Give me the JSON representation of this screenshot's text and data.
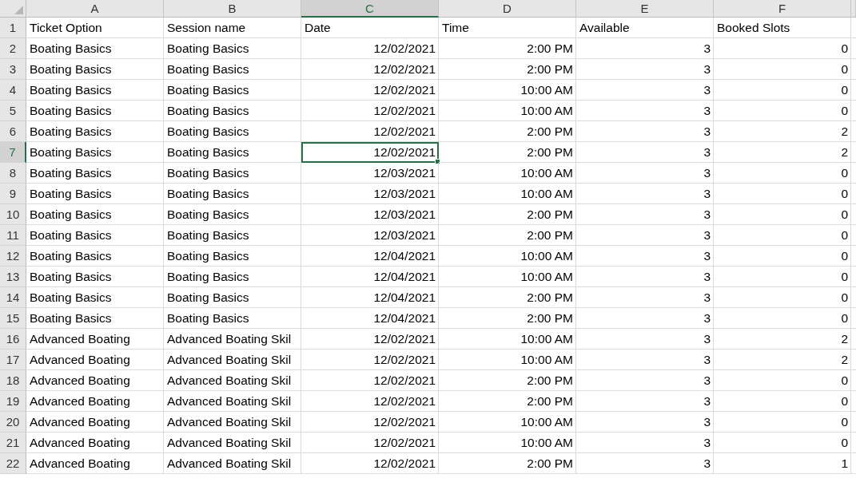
{
  "columns": [
    {
      "letter": "A",
      "selected": false,
      "kind": "text"
    },
    {
      "letter": "B",
      "selected": false,
      "kind": "text"
    },
    {
      "letter": "C",
      "selected": true,
      "kind": "number"
    },
    {
      "letter": "D",
      "selected": false,
      "kind": "number"
    },
    {
      "letter": "E",
      "selected": false,
      "kind": "number"
    },
    {
      "letter": "F",
      "selected": false,
      "kind": "number"
    }
  ],
  "rows": [
    {
      "number": "1",
      "selected": false,
      "kind": "header",
      "cells": [
        "Ticket Option",
        "Session name",
        "Date",
        "Time",
        "Available",
        "Booked Slots"
      ]
    },
    {
      "number": "2",
      "selected": false,
      "cells": [
        "Boating Basics",
        "Boating Basics",
        "12/02/2021",
        "2:00 PM",
        "3",
        "0"
      ]
    },
    {
      "number": "3",
      "selected": false,
      "cells": [
        "Boating Basics",
        "Boating Basics",
        "12/02/2021",
        "2:00 PM",
        "3",
        "0"
      ]
    },
    {
      "number": "4",
      "selected": false,
      "cells": [
        "Boating Basics",
        "Boating Basics",
        "12/02/2021",
        "10:00 AM",
        "3",
        "0"
      ]
    },
    {
      "number": "5",
      "selected": false,
      "cells": [
        "Boating Basics",
        "Boating Basics",
        "12/02/2021",
        "10:00 AM",
        "3",
        "0"
      ]
    },
    {
      "number": "6",
      "selected": false,
      "cells": [
        "Boating Basics",
        "Boating Basics",
        "12/02/2021",
        "2:00 PM",
        "3",
        "2"
      ]
    },
    {
      "number": "7",
      "selected": true,
      "cells": [
        "Boating Basics",
        "Boating Basics",
        "12/02/2021",
        "2:00 PM",
        "3",
        "2"
      ]
    },
    {
      "number": "8",
      "selected": false,
      "cells": [
        "Boating Basics",
        "Boating Basics",
        "12/03/2021",
        "10:00 AM",
        "3",
        "0"
      ]
    },
    {
      "number": "9",
      "selected": false,
      "cells": [
        "Boating Basics",
        "Boating Basics",
        "12/03/2021",
        "10:00 AM",
        "3",
        "0"
      ]
    },
    {
      "number": "10",
      "selected": false,
      "cells": [
        "Boating Basics",
        "Boating Basics",
        "12/03/2021",
        "2:00 PM",
        "3",
        "0"
      ]
    },
    {
      "number": "11",
      "selected": false,
      "cells": [
        "Boating Basics",
        "Boating Basics",
        "12/03/2021",
        "2:00 PM",
        "3",
        "0"
      ]
    },
    {
      "number": "12",
      "selected": false,
      "cells": [
        "Boating Basics",
        "Boating Basics",
        "12/04/2021",
        "10:00 AM",
        "3",
        "0"
      ]
    },
    {
      "number": "13",
      "selected": false,
      "cells": [
        "Boating Basics",
        "Boating Basics",
        "12/04/2021",
        "10:00 AM",
        "3",
        "0"
      ]
    },
    {
      "number": "14",
      "selected": false,
      "cells": [
        "Boating Basics",
        "Boating Basics",
        "12/04/2021",
        "2:00 PM",
        "3",
        "0"
      ]
    },
    {
      "number": "15",
      "selected": false,
      "cells": [
        "Boating Basics",
        "Boating Basics",
        "12/04/2021",
        "2:00 PM",
        "3",
        "0"
      ]
    },
    {
      "number": "16",
      "selected": false,
      "cells": [
        "Advanced Boating",
        "Advanced Boating Skil",
        "12/02/2021",
        "10:00 AM",
        "3",
        "2"
      ]
    },
    {
      "number": "17",
      "selected": false,
      "cells": [
        "Advanced Boating",
        "Advanced Boating Skil",
        "12/02/2021",
        "10:00 AM",
        "3",
        "2"
      ]
    },
    {
      "number": "18",
      "selected": false,
      "cells": [
        "Advanced Boating",
        "Advanced Boating Skil",
        "12/02/2021",
        "2:00 PM",
        "3",
        "0"
      ]
    },
    {
      "number": "19",
      "selected": false,
      "cells": [
        "Advanced Boating",
        "Advanced Boating Skil",
        "12/02/2021",
        "2:00 PM",
        "3",
        "0"
      ]
    },
    {
      "number": "20",
      "selected": false,
      "cells": [
        "Advanced Boating",
        "Advanced Boating Skil",
        "12/02/2021",
        "10:00 AM",
        "3",
        "0"
      ]
    },
    {
      "number": "21",
      "selected": false,
      "cells": [
        "Advanced Boating",
        "Advanced Boating Skil",
        "12/02/2021",
        "10:00 AM",
        "3",
        "0"
      ]
    },
    {
      "number": "22",
      "selected": false,
      "cells": [
        "Advanced Boating",
        "Advanced Boating Skil",
        "12/02/2021",
        "2:00 PM",
        "3",
        "1"
      ]
    }
  ]
}
